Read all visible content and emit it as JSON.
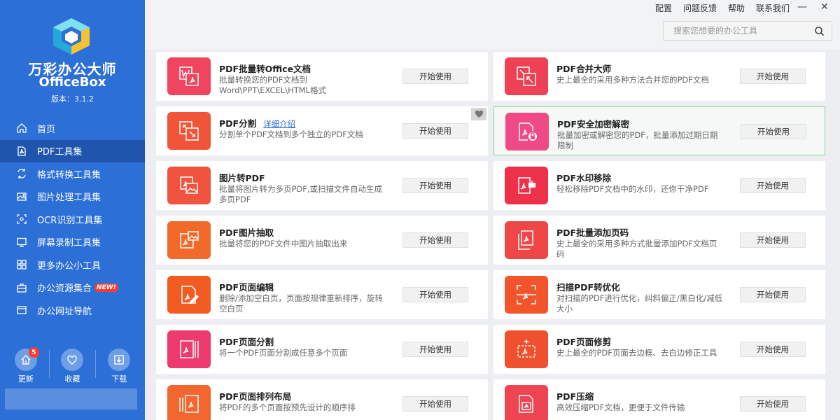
{
  "app": {
    "name_cn": "万彩办公大师",
    "name_en": "OfficeBox",
    "version": "版本：3.1.2"
  },
  "top_links": [
    "配置",
    "问题反馈",
    "帮助",
    "联系我们"
  ],
  "window_controls": {
    "minimize": "—",
    "close": "✕"
  },
  "search": {
    "placeholder": "搜索您想要的办公工具"
  },
  "nav": [
    {
      "label": "首页",
      "icon": "home-icon"
    },
    {
      "label": "PDF工具集",
      "icon": "pdf-icon",
      "active": true
    },
    {
      "label": "格式转换工具集",
      "icon": "convert-icon"
    },
    {
      "label": "图片处理工具集",
      "icon": "image-icon"
    },
    {
      "label": "OCR识别工具集",
      "icon": "ocr-icon"
    },
    {
      "label": "屏幕录制工具集",
      "icon": "monitor-icon"
    },
    {
      "label": "更多办公小工具",
      "icon": "grid-icon"
    },
    {
      "label": "办公资源集合",
      "icon": "toolbox-icon",
      "badge": "NEW!"
    },
    {
      "label": "办公网址导航",
      "icon": "browser-icon"
    }
  ],
  "bottom_tools": [
    {
      "label": "更新",
      "icon": "update-icon",
      "badge": "5"
    },
    {
      "label": "收藏",
      "icon": "heart-icon"
    },
    {
      "label": "下载",
      "icon": "download-icon"
    }
  ],
  "cards": [
    {
      "title": "PDF批量转Office文档",
      "desc": "批量转换您的PDF文档到Word\\PPT\\EXCEL\\HTML格式",
      "button": "开始使用",
      "icon": "pdf-to-office-icon",
      "color": "#f0445f"
    },
    {
      "title": "PDF合并大师",
      "desc": "史上最全的采用多种方法合并您的PDF文档",
      "button": "开始使用",
      "icon": "pdf-merge-icon",
      "color": "#ef4155"
    },
    {
      "title": "PDF分割",
      "link": "详细介绍",
      "desc": "分割单个PDF文档到多个独立的PDF文档",
      "button": "开始使用",
      "icon": "pdf-split-icon",
      "color": "#f05537"
    },
    {
      "title": "PDF安全加密解密",
      "desc": "批量加密或解密您的PDF，批量添加过期日期限制",
      "button": "开始使用",
      "icon": "pdf-lock-icon",
      "color": "#ef4a86"
    },
    {
      "title": "图片转PDF",
      "desc": "批量将图片转为多页PDF,或扫描文件自动生成多页PDF",
      "button": "开始使用",
      "icon": "image-to-pdf-icon",
      "color": "#f0543f"
    },
    {
      "title": "PDF水印移除",
      "desc": "轻松移除PDF文档中的水印，还你干净PDF",
      "button": "开始使用",
      "icon": "watermark-remove-icon",
      "color": "#ee3149"
    },
    {
      "title": "PDF图片抽取",
      "desc": "批量将您的PDF文件中图片抽取出来",
      "button": "开始使用",
      "icon": "image-extract-icon",
      "color": "#f26a2a"
    },
    {
      "title": "PDF批量添加页码",
      "desc": "史上最全的采用多种方式批量添加PDF文档页码",
      "button": "开始使用",
      "icon": "page-number-icon",
      "color": "#ef4748"
    },
    {
      "title": "PDF页面编辑",
      "desc": "删除/添加空白页，页面按规律重新排序，旋转空白页",
      "button": "开始使用",
      "icon": "page-edit-icon",
      "color": "#f25b22"
    },
    {
      "title": "扫描PDF转优化",
      "desc": "对扫描的PDF进行优化，纠斜偏正/黑白化/减低大小",
      "button": "开始使用",
      "icon": "scan-optimize-icon",
      "color": "#f2552b"
    },
    {
      "title": "PDF页面分割",
      "desc": "将一个PDF页面分割成任意多个页面",
      "button": "开始使用",
      "icon": "page-split-icon",
      "color": "#ee3a6c"
    },
    {
      "title": "PDF页面修剪",
      "desc": "史上最全的PDF页面去边框、去白边修正工具",
      "button": "开始使用",
      "icon": "page-crop-icon",
      "color": "#f0502d"
    },
    {
      "title": "PDF页面排列布局",
      "desc": "将PDF的多个页面按预先设计的顺序排",
      "button": "开始使用",
      "icon": "page-layout-icon",
      "color": "#f26630"
    },
    {
      "title": "PDF压缩",
      "desc": "高效压缩PDF文档，更便于文件传输",
      "button": "开始使用",
      "icon": "pdf-compress-icon",
      "color": "#ef4451"
    }
  ]
}
